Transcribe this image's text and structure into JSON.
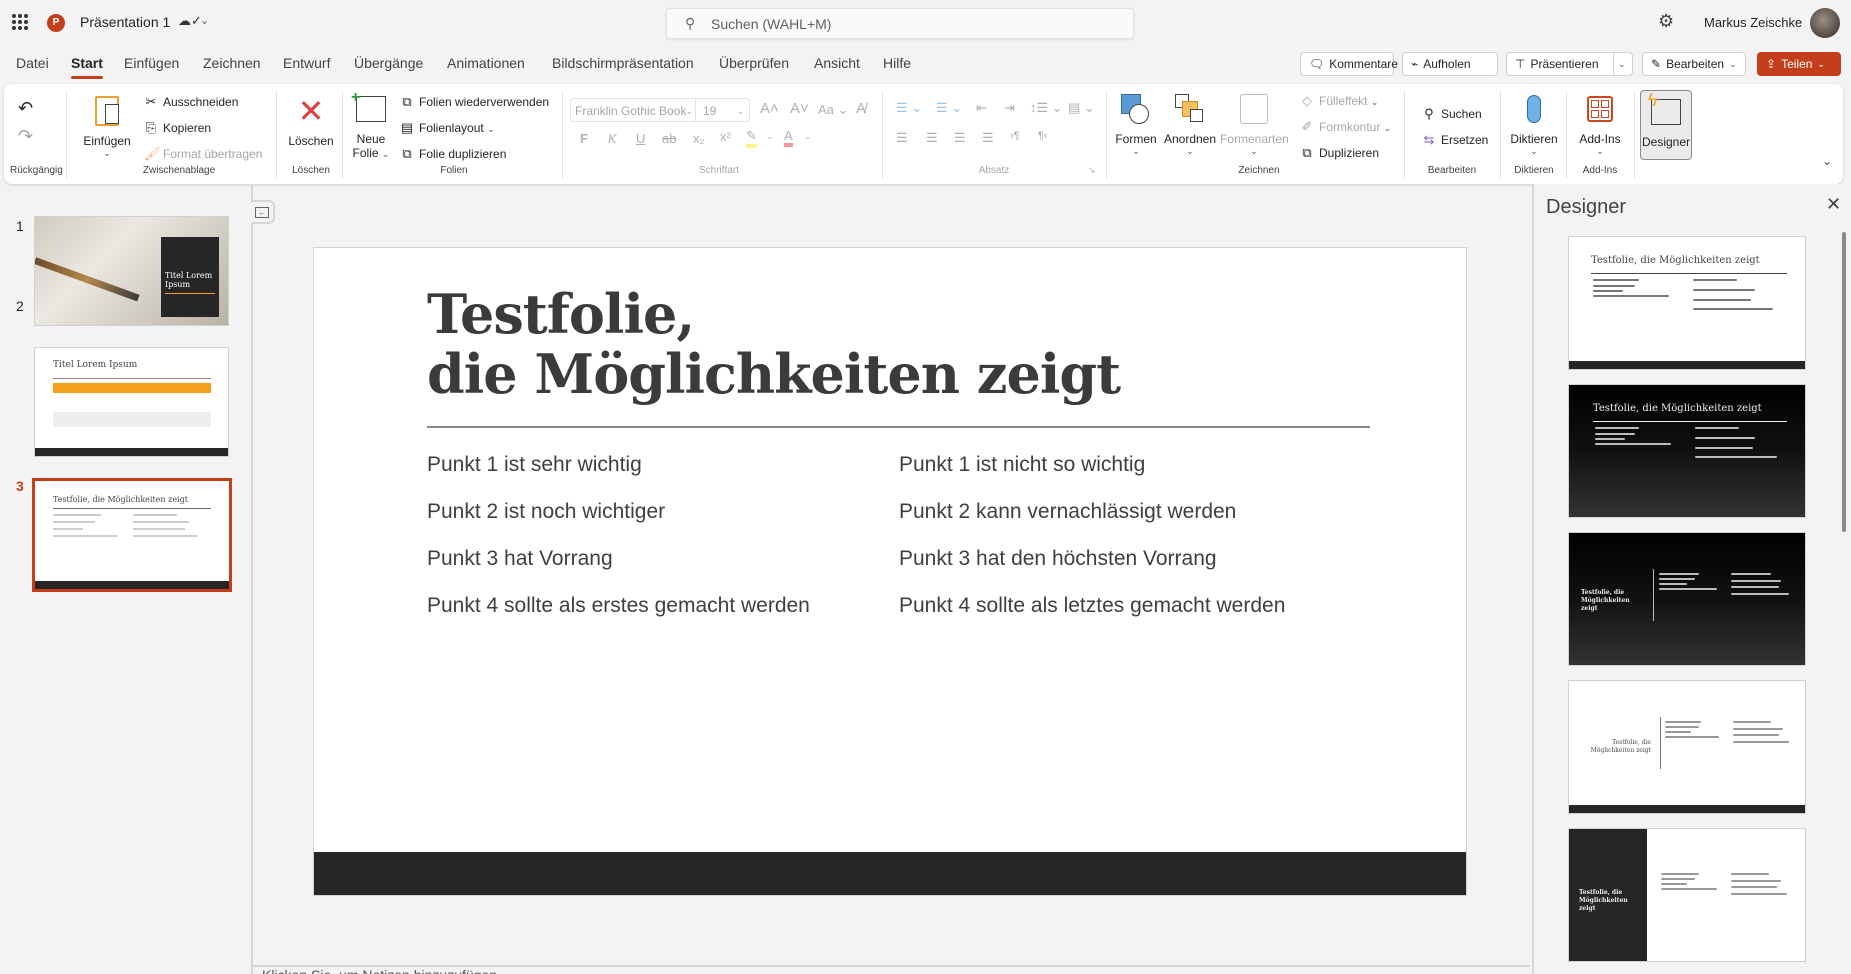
{
  "titlebar": {
    "app_icon": "powerpoint-logo",
    "app_letter": "P",
    "doc_title": "Präsentation 1",
    "save_status_icon": "cloud-saved-icon",
    "search_placeholder": "Suchen (WAHL+M)",
    "settings_icon": "gear-icon",
    "user_name": "Markus Zeischke"
  },
  "tabs": [
    "Datei",
    "Start",
    "Einfügen",
    "Zeichnen",
    "Entwurf",
    "Übergänge",
    "Animationen",
    "Bildschirmpräsentation",
    "Überprüfen",
    "Ansicht",
    "Hilfe"
  ],
  "active_tab": "Start",
  "top_buttons": {
    "comments": "Kommentare",
    "catchup": "Aufholen",
    "present": "Präsentieren",
    "edit": "Bearbeiten",
    "share": "Teilen"
  },
  "ribbon": {
    "undo_group": "Rückgängig",
    "clipboard": {
      "label": "Zwischenablage",
      "paste": "Einfügen",
      "cut": "Ausschneiden",
      "copy": "Kopieren",
      "format_painter": "Format übertragen"
    },
    "delete": {
      "label": "Löschen",
      "button": "Löschen"
    },
    "slides": {
      "label": "Folien",
      "new_slide_1": "Neue",
      "new_slide_2": "Folie",
      "reuse": "Folien wiederverwenden",
      "layout": "Folienlayout",
      "duplicate": "Folie duplizieren"
    },
    "font": {
      "label": "Schriftart",
      "family": "Franklin Gothic Book",
      "size": "19",
      "bold": "F",
      "italic": "K",
      "underline": "U",
      "strike": "ab"
    },
    "paragraph": {
      "label": "Absatz"
    },
    "drawing": {
      "label": "Zeichnen",
      "shapes": "Formen",
      "arrange": "Anordnen",
      "styles": "Formenarten",
      "fill": "Fülleffekt",
      "outline": "Formkontur",
      "duplicate": "Duplizieren"
    },
    "editing": {
      "label": "Bearbeiten",
      "find": "Suchen",
      "replace": "Ersetzen"
    },
    "dictate": {
      "label": "Diktieren",
      "button": "Diktieren"
    },
    "addins": {
      "label": "Add-Ins",
      "button": "Add-Ins"
    },
    "designer": {
      "button": "Designer"
    }
  },
  "slides": [
    {
      "number": "1",
      "title": "Titel Lorem Ipsum",
      "active": false
    },
    {
      "number": "2",
      "title": "Titel Lorem Ipsum",
      "active": false
    },
    {
      "number": "3",
      "title": "Testfolie, die Möglichkeiten zeigt",
      "active": true
    }
  ],
  "current_slide": {
    "title_line1": "Testfolie,",
    "title_line2": "die Möglichkeiten zeigt",
    "left_column": [
      "Punkt 1 ist sehr wichtig",
      "Punkt 2 ist noch wichtiger",
      "Punkt 3 hat Vorrang",
      "Punkt 4 sollte als erstes gemacht werden"
    ],
    "right_column": [
      "Punkt 1 ist nicht so wichtig",
      "Punkt 2 kann vernachlässigt werden",
      "Punkt 3 hat den höchsten Vorrang",
      "Punkt 4 sollte als letztes gemacht werden"
    ]
  },
  "notes_placeholder": "Klicken Sie, um Notizen hinzuzufügen",
  "designer": {
    "title": "Designer",
    "mini_title": "Testfolie, die Möglichkeiten zeigt",
    "mini_title_two_line": "Testfolie, die Möglichkeiten zeigt",
    "designs": [
      "light-top-title",
      "dark-gradient-top-title",
      "dark-gradient-side-title",
      "light-side-title",
      "dark-sidebar"
    ]
  },
  "colors": {
    "accent": "#c43e1c",
    "slide_footer": "#262626",
    "title_text": "#3b3b3b",
    "orange": "#f5a11c"
  }
}
